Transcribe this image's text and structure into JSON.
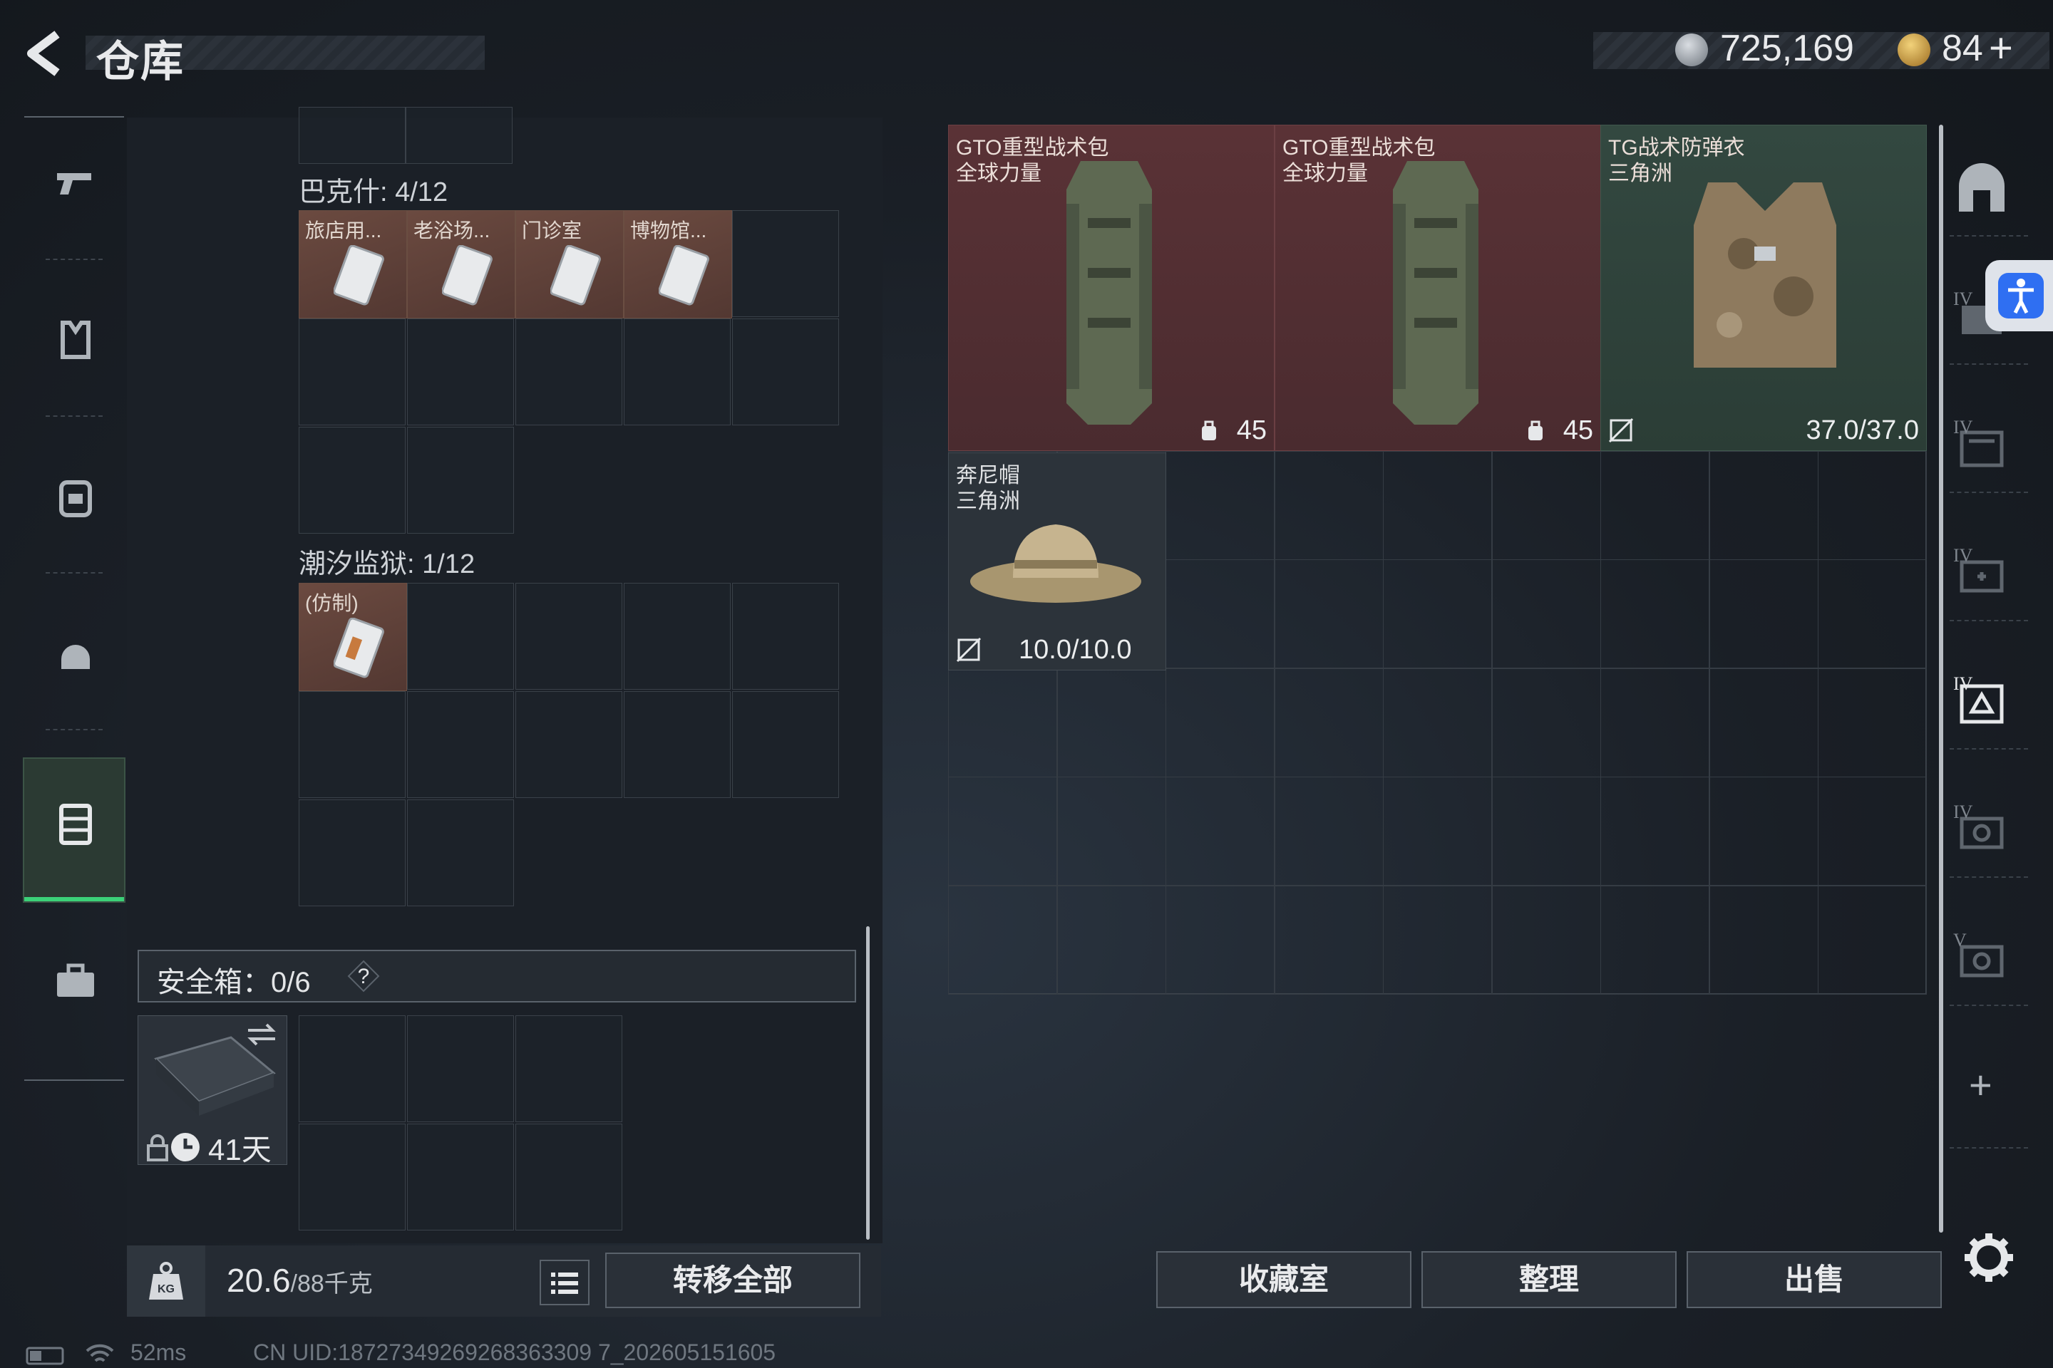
{
  "header": {
    "title": "仓库",
    "currency_1": "725,169",
    "currency_2": "84",
    "add_label": "+"
  },
  "left_rail": {
    "items": [
      {
        "name": "weapon",
        "icon": "pistol-icon"
      },
      {
        "name": "armor-vest",
        "icon": "vest-icon"
      },
      {
        "name": "backpack",
        "icon": "backpack-icon"
      },
      {
        "name": "helmet",
        "icon": "helmet-icon"
      },
      {
        "name": "container",
        "icon": "container-icon",
        "active": true
      },
      {
        "name": "case",
        "icon": "briefcase-icon"
      }
    ]
  },
  "containers": [
    {
      "label": "巴克什: 4/12",
      "items": [
        "旅店用...",
        "老浴场...",
        "门诊室",
        "博物馆..."
      ]
    },
    {
      "label": "潮汐监狱: 1/12",
      "items": [
        "(仿制)"
      ]
    }
  ],
  "safebox": {
    "label": "安全箱：0/6",
    "help": "?",
    "swap_icon": "swap-icon",
    "days": "41天"
  },
  "weight": {
    "current": "20.6",
    "max": "/88",
    "unit": "千克"
  },
  "transfer_all": "转移全部",
  "stash": {
    "items": [
      {
        "name": "GTO重型战术包",
        "sub": "全球力量",
        "stat": "45",
        "rarity": "red"
      },
      {
        "name": "GTO重型战术包",
        "sub": "全球力量",
        "stat": "45",
        "rarity": "red"
      },
      {
        "name": "TG战术防弹衣",
        "sub": "三角洲",
        "stat": "37.0/37.0",
        "rarity": "green"
      },
      {
        "name": "奔尼帽",
        "sub": "三角洲",
        "stat": "10.0/10.0",
        "rarity": "gray"
      }
    ]
  },
  "right_rail": {
    "tiers": [
      "IV",
      "IV",
      "IV",
      "IV",
      "IV",
      "V"
    ],
    "add": "+"
  },
  "actions": {
    "collection": "收藏室",
    "sort": "整理",
    "sell": "出售"
  },
  "status": {
    "ping": "52ms",
    "uid": "CN UID:18727349269268363309 7_202605151605"
  },
  "colors": {
    "accent_green": "#3bd178",
    "rarity_red": "#5a3236",
    "rarity_green": "#334840",
    "container_item": "#6b4a40",
    "accessibility": "#2f6ff2"
  }
}
